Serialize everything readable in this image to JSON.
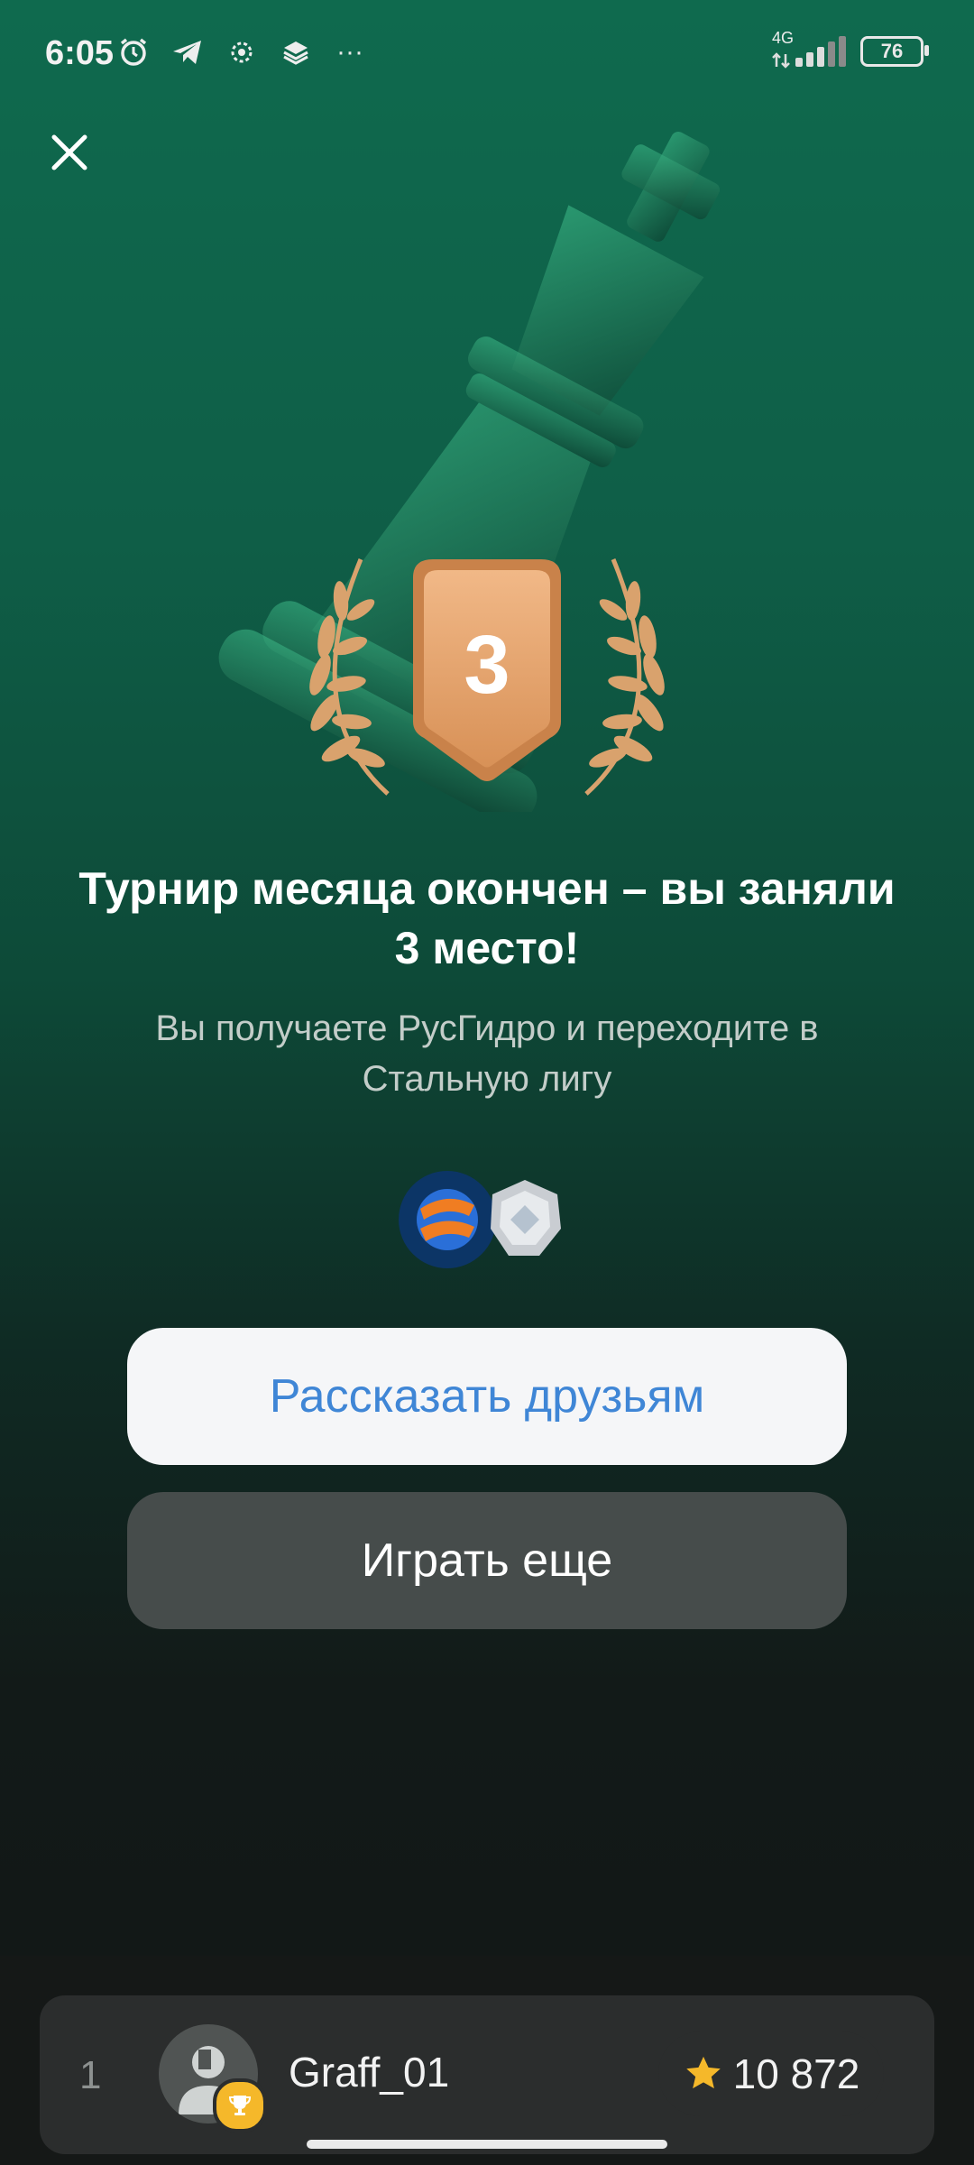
{
  "status_bar": {
    "time": "6:05",
    "network": "4G",
    "battery": "76",
    "more": "···"
  },
  "result": {
    "place": "3",
    "title": "Турнир месяца окончен – вы заняли 3 место!",
    "subtitle": "Вы получаете РусГидро и переходите в Стальную лигу"
  },
  "buttons": {
    "share": "Рассказать друзьям",
    "play": "Играть еще"
  },
  "leaderboard": {
    "rank": "1",
    "username": "Graff_01",
    "score": "10 872"
  },
  "colors": {
    "accent_blue": "#3f86d6",
    "bronze": "#e0a06a",
    "star": "#f5b82a"
  }
}
